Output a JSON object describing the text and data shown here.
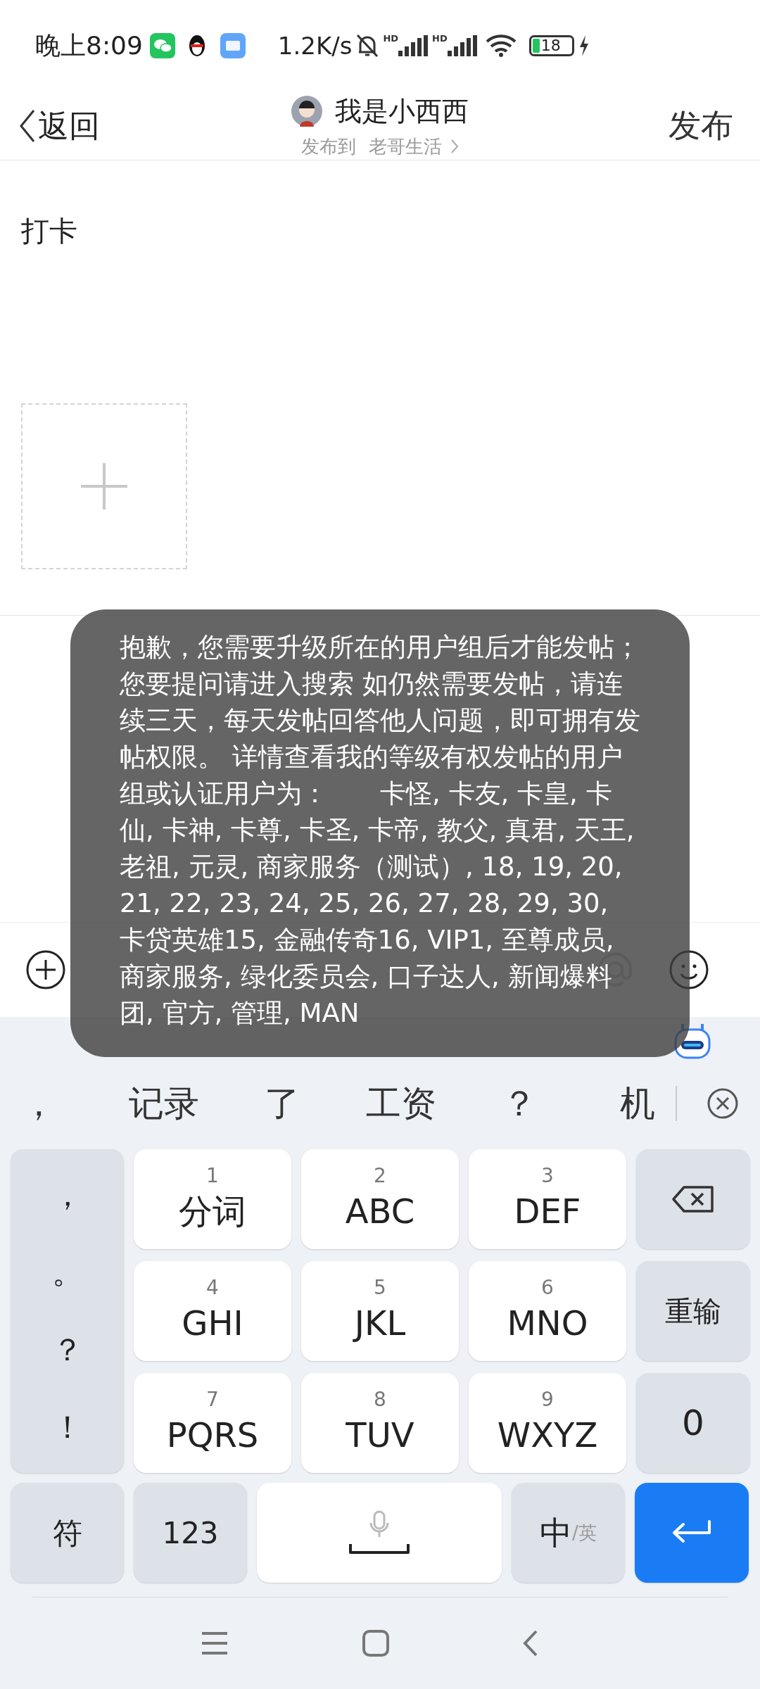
{
  "status_bar": {
    "time": "晚上8:09",
    "speed": "1.2K/s",
    "signal_labels": [
      "HD",
      "HD"
    ],
    "battery": "18"
  },
  "header": {
    "back": "返回",
    "author": "我是小西西",
    "publish_to_label": "发布到",
    "board": "老哥生活",
    "publish": "发布"
  },
  "post": {
    "text": "打卡"
  },
  "toast": {
    "message": "抱歉，您需要升级所在的用户组后才能发帖；您要提问请进入搜索 如仍然需要发帖，请连续三天，每天发帖回答他人问题，即可拥有发帖权限。 详情查看我的等级有权发帖的用户组或认证用户为：　　卡怪, 卡友, 卡皇, 卡仙, 卡神, 卡尊, 卡圣, 卡帝, 教父, 真君, 天王, 老祖, 元灵, 商家服务（测试）, 18, 19, 20, 21, 22, 23, 24, 25, 26, 27, 28, 29, 30, 卡贷英雄15, 金融传奇16, VIP1, 至尊成员, 商家服务, 绿化委员会, 口子达人, 新闻爆料团, 官方, 管理, MAN"
  },
  "candidates": [
    "，",
    "记录",
    "了",
    "工资",
    "？",
    "机"
  ],
  "keyboard": {
    "symbols": [
      "，",
      "。",
      "？",
      "！"
    ],
    "keys": [
      {
        "digit": "1",
        "label": "分词"
      },
      {
        "digit": "2",
        "label": "ABC"
      },
      {
        "digit": "3",
        "label": "DEF"
      },
      {
        "digit": "4",
        "label": "GHI"
      },
      {
        "digit": "5",
        "label": "JKL"
      },
      {
        "digit": "6",
        "label": "MNO"
      },
      {
        "digit": "7",
        "label": "PQRS"
      },
      {
        "digit": "8",
        "label": "TUV"
      },
      {
        "digit": "9",
        "label": "WXYZ"
      }
    ],
    "reset": "重输",
    "zero": "0",
    "symbol_key": "符",
    "number_key": "123",
    "lang_main": "中",
    "lang_alt": "/英"
  }
}
